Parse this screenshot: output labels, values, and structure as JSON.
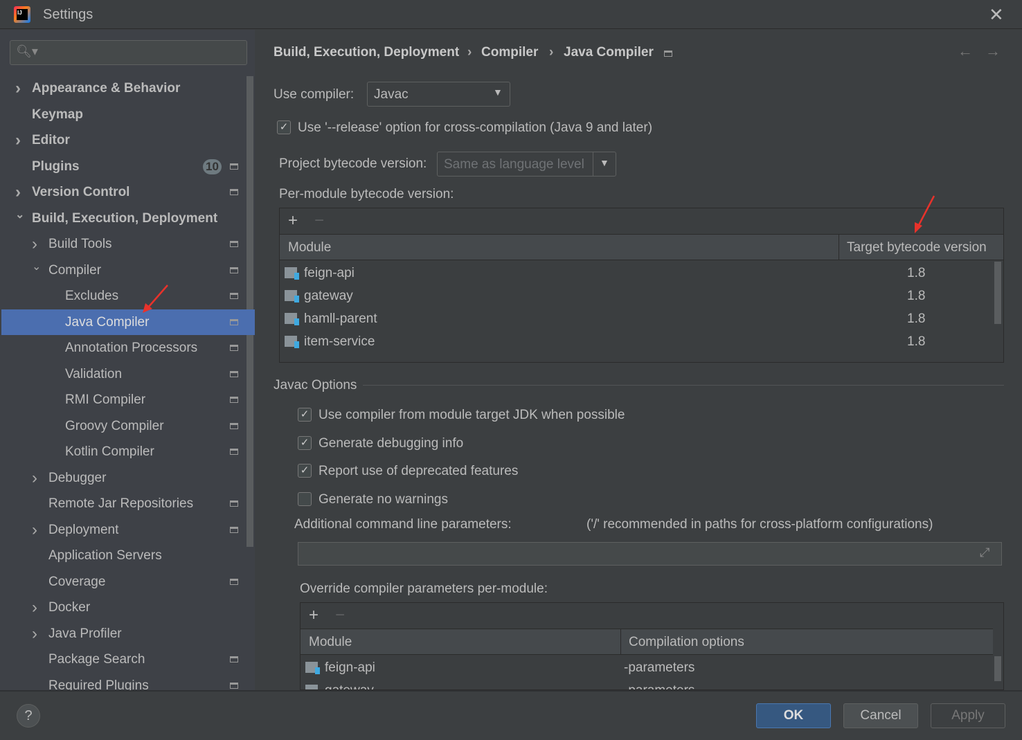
{
  "window": {
    "title": "Settings",
    "close_icon": "close-icon"
  },
  "sidebar": {
    "search": {
      "value": "",
      "placeholder": ""
    },
    "items": [
      {
        "label": "Appearance & Behavior",
        "bold": true,
        "expand": "collapsed",
        "level": 0
      },
      {
        "label": "Keymap",
        "bold": true,
        "level": 0
      },
      {
        "label": "Editor",
        "bold": true,
        "expand": "collapsed",
        "level": 0
      },
      {
        "label": "Plugins",
        "bold": true,
        "level": 0,
        "badge": "10",
        "pin": true
      },
      {
        "label": "Version Control",
        "bold": true,
        "expand": "collapsed",
        "level": 0,
        "pin": true
      },
      {
        "label": "Build, Execution, Deployment",
        "bold": true,
        "expand": "expanded",
        "level": 0
      },
      {
        "label": "Build Tools",
        "expand": "collapsed",
        "level": 1,
        "pin": true
      },
      {
        "label": "Compiler",
        "expand": "expanded",
        "level": 1,
        "pin": true
      },
      {
        "label": "Excludes",
        "level": 2,
        "pin": true
      },
      {
        "label": "Java Compiler",
        "level": 2,
        "pin": true,
        "selected": true
      },
      {
        "label": "Annotation Processors",
        "level": 2,
        "pin": true
      },
      {
        "label": "Validation",
        "level": 2,
        "pin": true
      },
      {
        "label": "RMI Compiler",
        "level": 2,
        "pin": true
      },
      {
        "label": "Groovy Compiler",
        "level": 2,
        "pin": true
      },
      {
        "label": "Kotlin Compiler",
        "level": 2,
        "pin": true
      },
      {
        "label": "Debugger",
        "expand": "collapsed",
        "level": 1
      },
      {
        "label": "Remote Jar Repositories",
        "level": 1,
        "pin": true
      },
      {
        "label": "Deployment",
        "expand": "collapsed",
        "level": 1,
        "pin": true
      },
      {
        "label": "Application Servers",
        "level": 1
      },
      {
        "label": "Coverage",
        "level": 1,
        "pin": true
      },
      {
        "label": "Docker",
        "expand": "collapsed",
        "level": 1
      },
      {
        "label": "Java Profiler",
        "expand": "collapsed",
        "level": 1
      },
      {
        "label": "Package Search",
        "level": 1,
        "pin": true
      },
      {
        "label": "Required Plugins",
        "level": 1,
        "pin": true
      }
    ]
  },
  "breadcrumb": [
    "Build, Execution, Deployment",
    "Compiler",
    "Java Compiler"
  ],
  "compiler": {
    "use_compiler_label": "Use compiler:",
    "use_compiler_value": "Javac",
    "release_option": {
      "label": "Use '--release' option for cross-compilation (Java 9 and later)",
      "checked": true
    },
    "project_bytecode_label": "Project bytecode version:",
    "project_bytecode_placeholder": "Same as language level",
    "per_module_label": "Per-module bytecode version:",
    "bytecode_table": {
      "headers": [
        "Module",
        "Target bytecode version"
      ],
      "rows": [
        [
          "feign-api",
          "1.8"
        ],
        [
          "gateway",
          "1.8"
        ],
        [
          "hamll-parent",
          "1.8"
        ],
        [
          "item-service",
          "1.8"
        ]
      ]
    }
  },
  "javac": {
    "section_title": "Javac Options",
    "options": [
      {
        "label": "Use compiler from module target JDK when possible",
        "checked": true
      },
      {
        "label": "Generate debugging info",
        "checked": true
      },
      {
        "label": "Report use of deprecated features",
        "checked": true
      },
      {
        "label": "Generate no warnings",
        "checked": false
      }
    ],
    "additional_label": "Additional command line parameters:",
    "additional_hint": "('/' recommended in paths for cross-platform configurations)",
    "additional_value": "",
    "override_label": "Override compiler parameters per-module:",
    "override_table": {
      "headers": [
        "Module",
        "Compilation options"
      ],
      "rows": [
        [
          "feign-api",
          "-parameters"
        ],
        [
          "gateway",
          "-parameters"
        ]
      ]
    }
  },
  "footer": {
    "help": "?",
    "ok": "OK",
    "cancel": "Cancel",
    "apply": "Apply"
  },
  "colors": {
    "selection": "#4b6eaf",
    "ok_button": "#365880",
    "annotation_arrow": "#e8322b"
  }
}
